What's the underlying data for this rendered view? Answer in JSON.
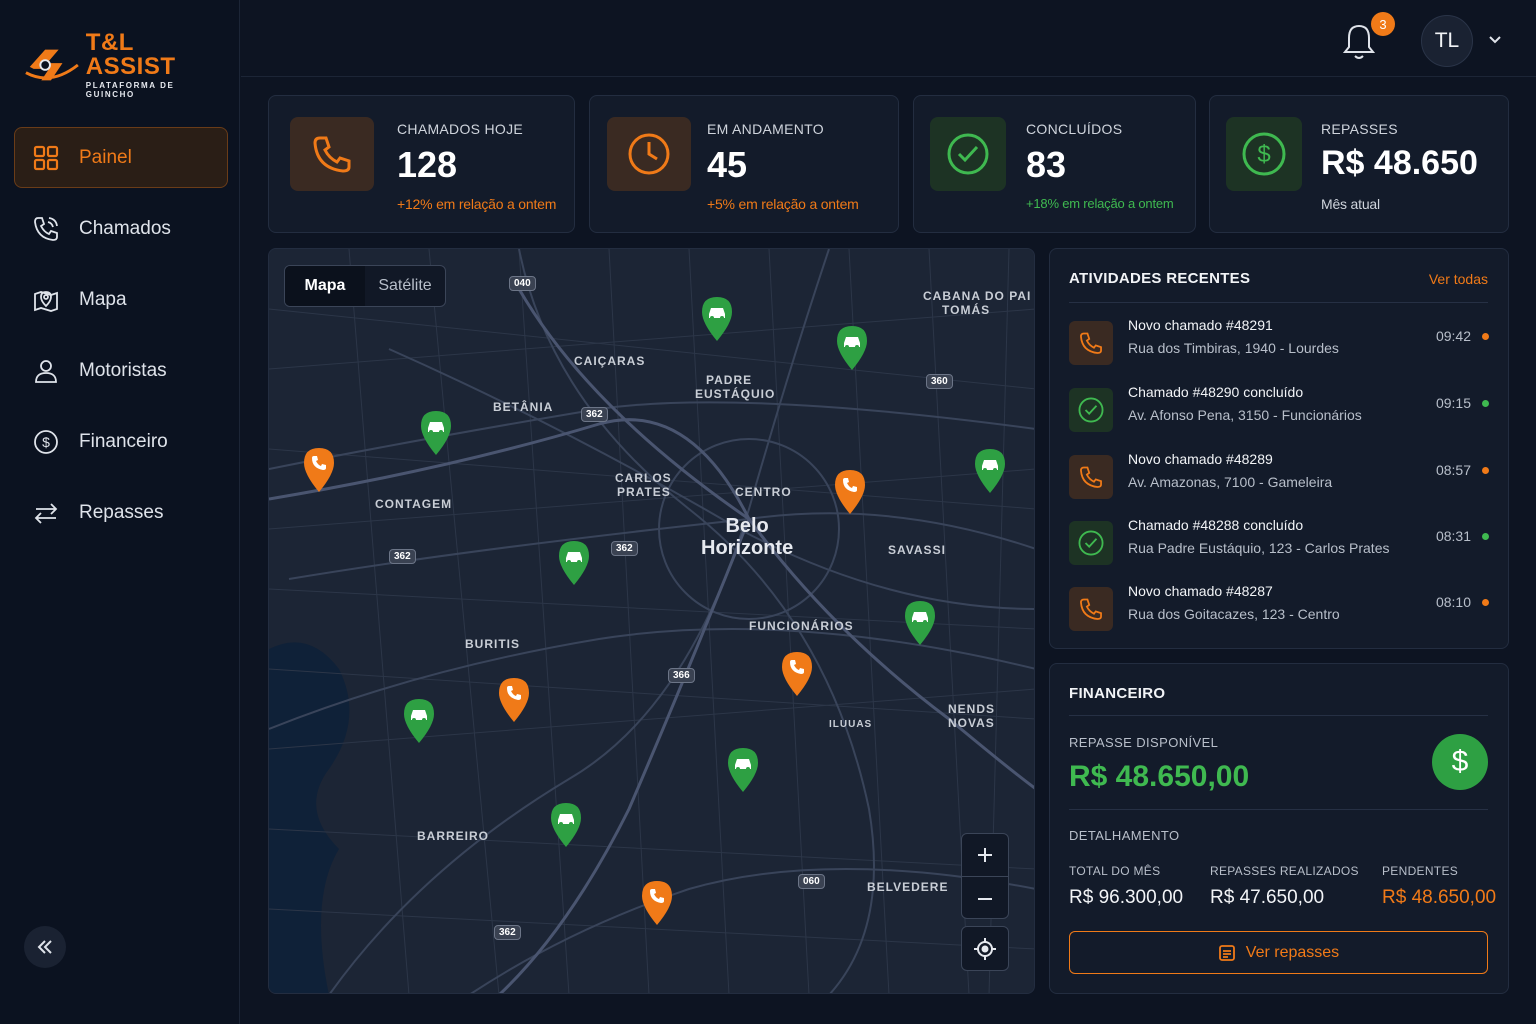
{
  "brand": {
    "title": "T&L ASSIST",
    "subtitle": "PLATAFORMA DE GUINCHO",
    "accent": "#f07a18"
  },
  "sidebar": {
    "items": [
      {
        "label": "Painel",
        "icon": "grid-icon",
        "active": true
      },
      {
        "label": "Chamados",
        "icon": "phone-call-icon"
      },
      {
        "label": "Mapa",
        "icon": "map-pin-icon"
      },
      {
        "label": "Motoristas",
        "icon": "user-icon"
      },
      {
        "label": "Financeiro",
        "icon": "dollar-circle-icon"
      },
      {
        "label": "Repasses",
        "icon": "transfer-arrows-icon"
      }
    ],
    "collapse_icon": "double-chevron-left-icon"
  },
  "topbar": {
    "notifications_count": "3",
    "avatar_initials": "TL"
  },
  "stats": [
    {
      "label": "CHAMADOS HOJE",
      "value": "128",
      "sub": "+12% em relação a ontem",
      "icon": "phone-icon",
      "tone": "orange"
    },
    {
      "label": "EM ANDAMENTO",
      "value": "45",
      "sub": "+5% em relação a ontem",
      "icon": "clock-icon",
      "tone": "orange"
    },
    {
      "label": "CONCLUÍDOS",
      "value": "83",
      "sub": "+18% em relação a ontem",
      "icon": "check-circle-icon",
      "tone": "green"
    },
    {
      "label": "REPASSES",
      "value": "R$ 48.650",
      "sub": "Mês atual",
      "icon": "dollar-circle-icon",
      "tone": "green"
    }
  ],
  "map": {
    "toggle": {
      "map": "Mapa",
      "satellite": "Satélite"
    },
    "city": {
      "line1": "Belo",
      "line2": "Horizonte"
    },
    "labels": [
      "CAIÇARAS",
      "PADRE",
      "EUSTÁQUIO",
      "BETÂNIA",
      "CABANA DO PAI",
      "TOMÁS",
      "CONTAGEM",
      "CARLOS",
      "PRATES",
      "CENTRO",
      "SAVASSI",
      "BURITIS",
      "FUNCIONÁRIOS",
      "NENDS",
      "NOVAS",
      "BARREIRO",
      "BELVEDERE",
      "ILUUAS"
    ],
    "highways": [
      "040",
      "362",
      "362",
      "362",
      "362",
      "366",
      "360",
      "060"
    ]
  },
  "activities": {
    "title": "ATIVIDADES RECENTES",
    "view_all": "Ver todas",
    "items": [
      {
        "title": "Novo chamado #48291",
        "address": "Rua dos Timbiras, 1940 - Lourdes",
        "time": "09:42",
        "type": "new"
      },
      {
        "title": "Chamado #48290 concluído",
        "address": "Av. Afonso Pena, 3150 - Funcionários",
        "time": "09:15",
        "type": "done"
      },
      {
        "title": "Novo chamado #48289",
        "address": "Av. Amazonas, 7100 - Gameleira",
        "time": "08:57",
        "type": "new"
      },
      {
        "title": "Chamado #48288 concluído",
        "address": "Rua Padre Eustáquio, 123 - Carlos Prates",
        "time": "08:31",
        "type": "done"
      },
      {
        "title": "Novo chamado #48287",
        "address": "Rua dos Goitacazes, 123 - Centro",
        "time": "08:10",
        "type": "new"
      }
    ]
  },
  "finance": {
    "title": "FINANCEIRO",
    "available_label": "REPASSE DISPONÍVEL",
    "available_value": "R$ 48.650,00",
    "detail_label": "DETALHAMENTO",
    "columns": [
      {
        "label": "TOTAL DO MÊS",
        "value": "R$ 96.300,00"
      },
      {
        "label": "REPASSES REALIZADOS",
        "value": "R$ 47.650,00"
      },
      {
        "label": "PENDENTES",
        "value": "R$ 48.650,00"
      }
    ],
    "button": "Ver repasses"
  }
}
